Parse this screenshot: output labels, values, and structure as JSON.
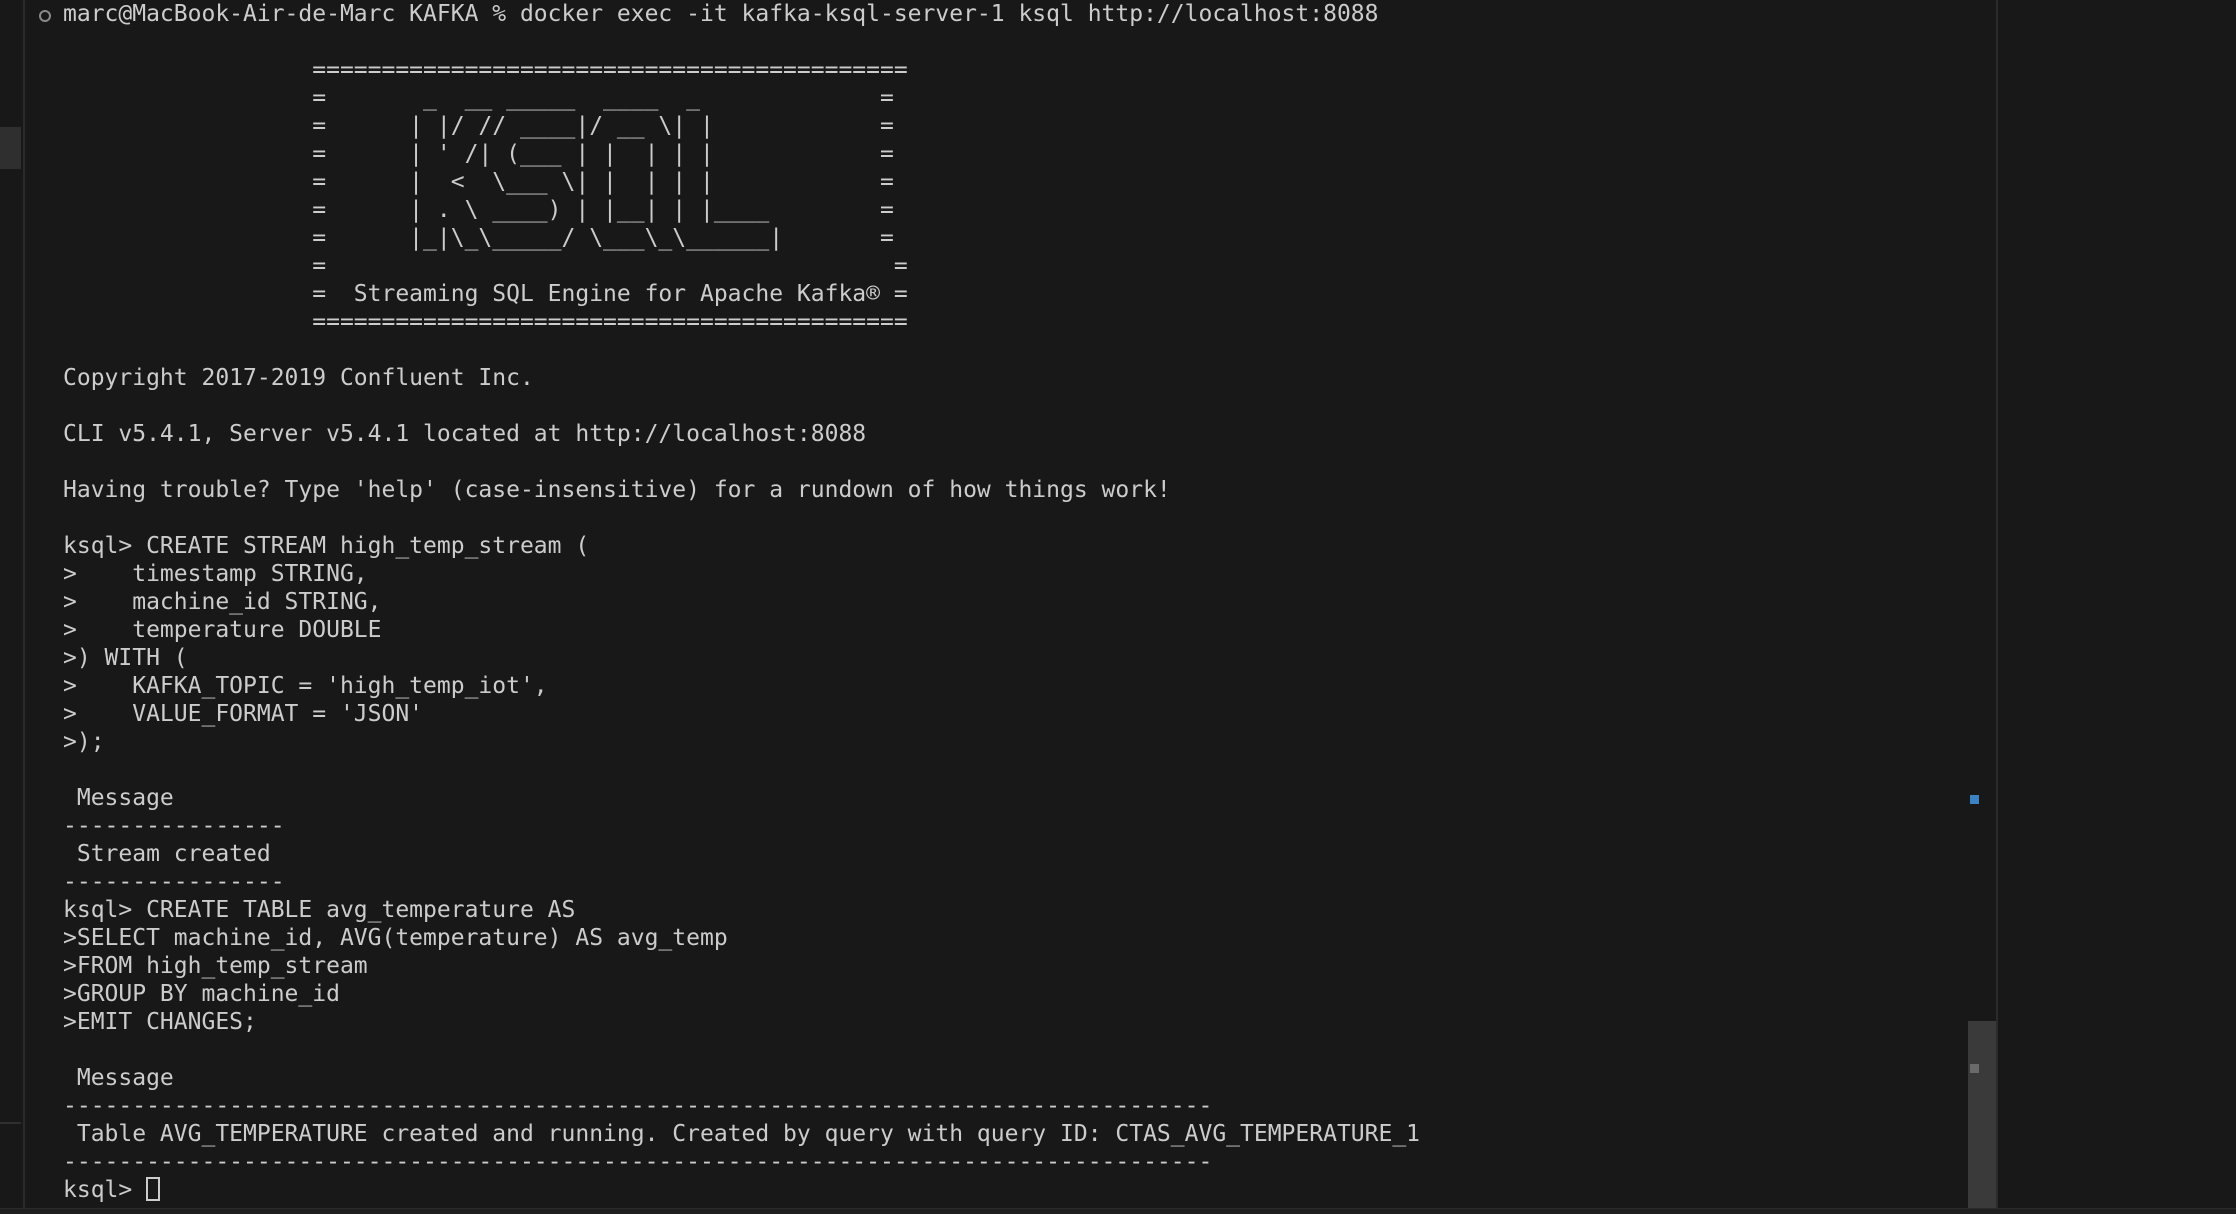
{
  "terminal": {
    "lines": [
      "marc@MacBook-Air-de-Marc KAFKA % docker exec -it kafka-ksql-server-1 ksql http://localhost:8088",
      "",
      "                  ===========================================",
      "                  =       _  __ _____  ____  _             =",
      "                  =      | |/ // ____|/ __ \\| |            =",
      "                  =      | ' /| (___ | |  | | |            =",
      "                  =      |  <  \\___ \\| |  | | |            =",
      "                  =      | . \\ ____) | |__| | |____        =",
      "                  =      |_|\\_\\_____/ \\___\\_\\______|       =",
      "                  =                                         =",
      "                  =  Streaming SQL Engine for Apache Kafka® =",
      "                  ===========================================",
      "",
      "Copyright 2017-2019 Confluent Inc.",
      "",
      "CLI v5.4.1, Server v5.4.1 located at http://localhost:8088",
      "",
      "Having trouble? Type 'help' (case-insensitive) for a rundown of how things work!",
      "",
      "ksql> CREATE STREAM high_temp_stream (",
      ">    timestamp STRING,",
      ">    machine_id STRING,",
      ">    temperature DOUBLE",
      ">) WITH (",
      ">    KAFKA_TOPIC = 'high_temp_iot',",
      ">    VALUE_FORMAT = 'JSON'",
      ">);",
      "",
      " Message",
      "----------------",
      " Stream created",
      "----------------",
      "ksql> CREATE TABLE avg_temperature AS",
      ">SELECT machine_id, AVG(temperature) AS avg_temp",
      ">FROM high_temp_stream",
      ">GROUP BY machine_id",
      ">EMIT CHANGES;",
      "",
      " Message",
      "-----------------------------------------------------------------------------------",
      " Table AVG_TEMPERATURE created and running. Created by query with query ID: CTAS_AVG_TEMPERATURE_1",
      "-----------------------------------------------------------------------------------"
    ],
    "prompt": "ksql> "
  },
  "icons": {
    "status": "circle-status-icon",
    "cursor": "block-cursor-icon"
  },
  "colors": {
    "background": "#181818",
    "text": "#cccccc",
    "scroll_marker": "#3b82c4"
  }
}
